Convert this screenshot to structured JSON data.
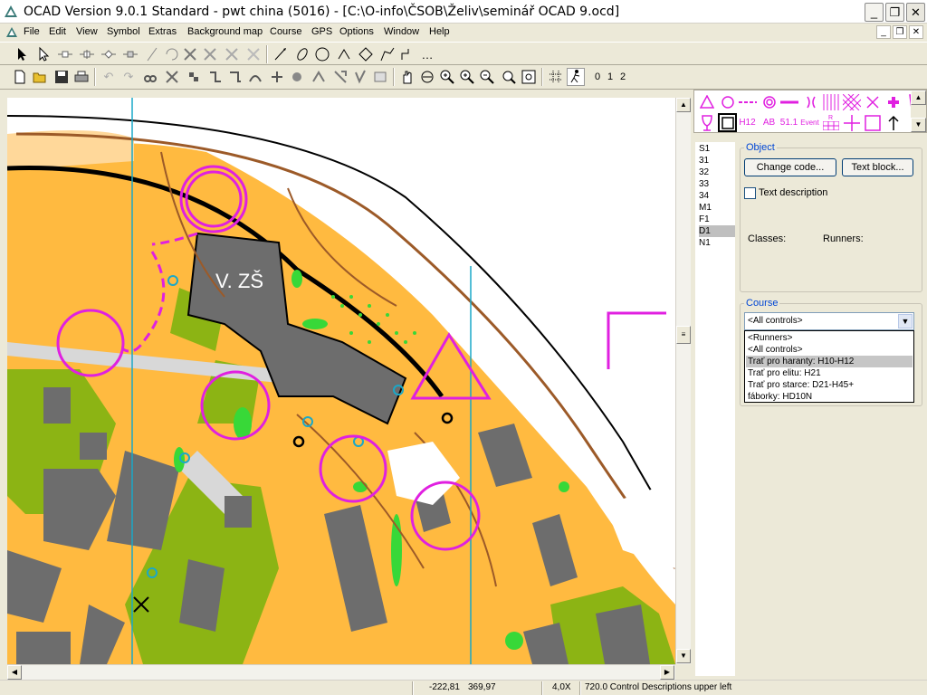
{
  "window": {
    "title": "OCAD Version 9.0.1  Standard - pwt china (5016) - [C:\\O-info\\ČSOB\\Želiv\\seminář OCAD 9.ocd]",
    "controls": [
      "_",
      "❐",
      "✕"
    ]
  },
  "menu": {
    "items": [
      "File",
      "Edit",
      "View",
      "Symbol",
      "Extras",
      "Background map",
      "Course",
      "GPS",
      "Options",
      "Window",
      "Help"
    ],
    "mdi_controls": [
      "_",
      "❐",
      "✕"
    ]
  },
  "toolbar2": {
    "layer_buttons": [
      "0",
      "1",
      "2"
    ]
  },
  "map": {
    "building_label": "V. ZŠ"
  },
  "symbols": {
    "labels": [
      "H12",
      "AB",
      "51.1",
      "Event",
      "R"
    ]
  },
  "codes": {
    "items": [
      "S1",
      "31",
      "32",
      "33",
      "34",
      "M1",
      "F1",
      "D1",
      "N1"
    ],
    "selected": "D1"
  },
  "object_panel": {
    "legend": "Object",
    "change_code": "Change code...",
    "text_block": "Text block...",
    "text_description": "Text description",
    "classes_label": "Classes:",
    "runners_label": "Runners:"
  },
  "course_panel": {
    "legend": "Course",
    "selected": "<All controls>",
    "options": [
      "<Runners>",
      "<All controls>",
      "Trať pro haranty: H10-H12",
      "Trať pro elitu: H21",
      "Trať pro starce: D21-H45+",
      "fáborky: HD10N"
    ],
    "highlighted_index": 2
  },
  "status": {
    "x": "-222,81",
    "y": "369,97",
    "zoom": "4,0X",
    "info": "720.0 Control Descriptions upper left"
  },
  "colors": {
    "course_magenta": "#e020e0",
    "building": "#6d6d6d",
    "open_land": "#ffba40",
    "green": "#38d838",
    "olive": "#8cb414",
    "water_line": "#1aa8c8",
    "path": "#9c5a28"
  }
}
